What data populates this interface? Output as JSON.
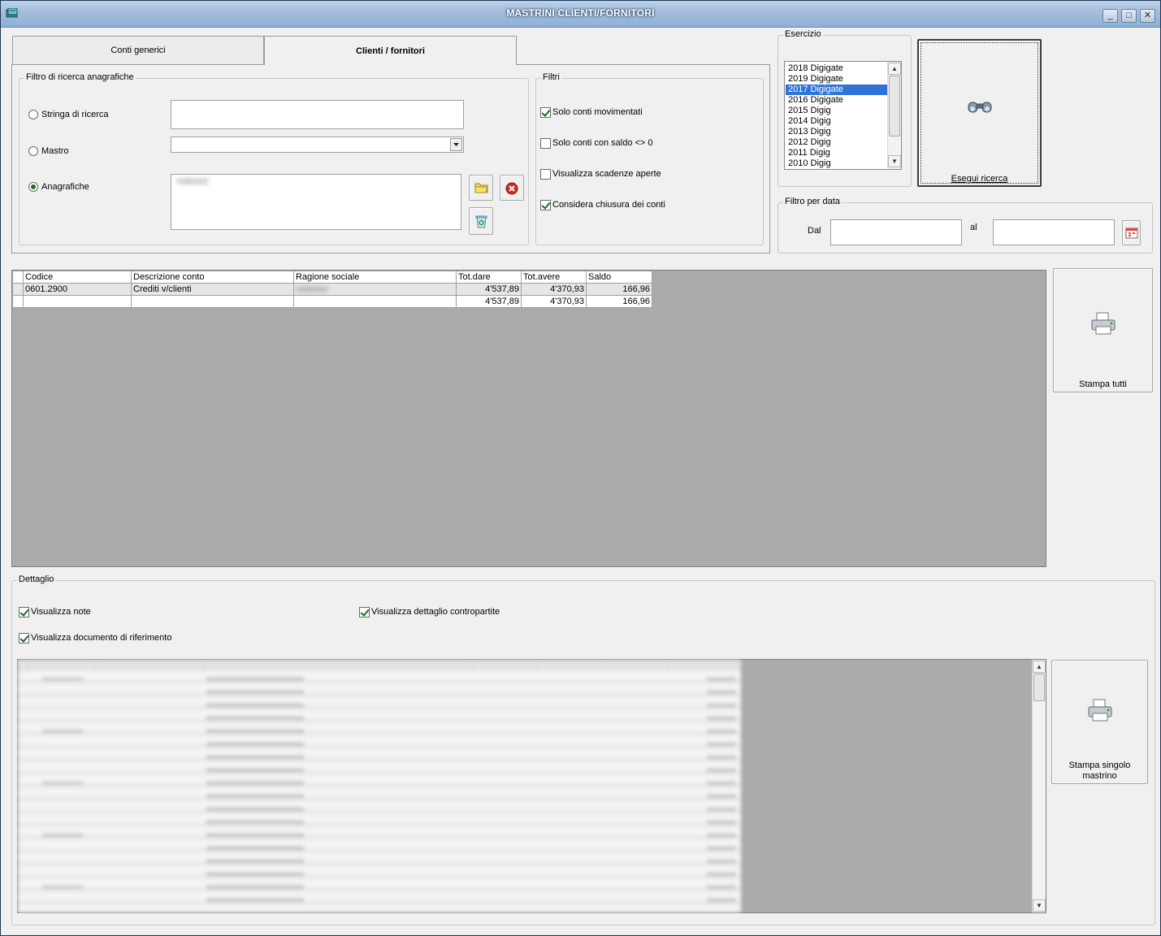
{
  "window": {
    "title": "MASTRINI CLIENTI/FORNITORI",
    "min": "_",
    "max": "□",
    "close": "✕"
  },
  "tabs": [
    {
      "label": "Conti generici",
      "active": false
    },
    {
      "label": "Clienti / fornitori",
      "active": true
    }
  ],
  "filtro_anagrafiche": {
    "legend": "Filtro di ricerca anagrafiche",
    "stringa_label": "Stringa di ricerca",
    "stringa_value": "",
    "mastro_label": "Mastro",
    "mastro_value": "",
    "anagrafiche_label": "Anagrafiche",
    "anagrafiche_value": "redacted"
  },
  "filtri": {
    "legend": "Filtri",
    "items": [
      {
        "label": "Solo conti movimentati",
        "checked": true
      },
      {
        "label": "Solo conti con saldo <> 0",
        "checked": false
      },
      {
        "label": "Visualizza scadenze aperte",
        "checked": false
      },
      {
        "label": "Considera chiusura dei conti",
        "checked": true
      }
    ]
  },
  "esercizio": {
    "legend": "Esercizio",
    "years": [
      "2018 Digigate",
      "2019 Digigate",
      "2017 Digigate",
      "2016 Digigate",
      "2015 Digig",
      "2014 Digig",
      "2013 Digig",
      "2012 Digig",
      "2011 Digig",
      "2010 Digig"
    ],
    "selected_index": 2
  },
  "esegui": {
    "label": "Esegui ricerca"
  },
  "filtro_data": {
    "legend": "Filtro per data",
    "dal_label": "Dal",
    "al_label": "al",
    "dal_value": "",
    "al_value": ""
  },
  "results": {
    "headers": [
      "Codice",
      "Descrizione conto",
      "Ragione sociale",
      "Tot.dare",
      "Tot.avere",
      "Saldo"
    ],
    "rows": [
      {
        "codice": "0601.2900",
        "descrizione": "Crediti v/clienti",
        "ragione": "redacted",
        "dare": "4'537,89",
        "avere": "4'370,93",
        "saldo": "166,96"
      }
    ],
    "totals": {
      "dare": "4'537,89",
      "avere": "4'370,93",
      "saldo": "166,96"
    }
  },
  "stampa_tutti": {
    "label": "Stampa tutti"
  },
  "dettaglio": {
    "legend": "Dettaglio",
    "visualizza_note": {
      "label": "Visualizza note",
      "checked": true
    },
    "visualizza_contropartite": {
      "label": "Visualizza dettaglio contropartite",
      "checked": true
    },
    "visualizza_documento": {
      "label": "Visualizza documento di riferimento",
      "checked": true
    }
  },
  "stampa_singolo": {
    "label": "Stampa singolo mastrino"
  },
  "colors": {
    "selection": "#2f73d8",
    "grid_bg": "#ababab",
    "window_bg": "#f0f0f0"
  }
}
